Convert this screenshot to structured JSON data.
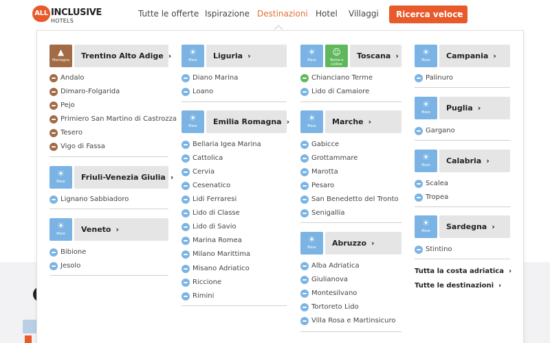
{
  "logo": {
    "all": "ALL",
    "inclusive": "INCLUSIVE",
    "hotels": "HOTELS"
  },
  "nav": {
    "items": [
      "Tutte le offerte",
      "Ispirazione",
      "Destinazioni",
      "Hotel",
      "Villaggi"
    ],
    "active": "Destinazioni",
    "cta": "Ricerca veloce",
    "chevron": "›"
  },
  "badges": {
    "mare": "Mare",
    "montagna": "Montagna",
    "terme": "Terme e colline"
  },
  "colors": {
    "accent": "#e85a2a",
    "mare": "#7bb4e4",
    "montagna": "#a26b45",
    "terme": "#5fb85c"
  },
  "regions": {
    "trentino": {
      "name": "Trentino Alto Adige",
      "items": [
        "Andalo",
        "Dimaro-Folgarida",
        "Pejo",
        "Primiero San Martino di Castrozza",
        "Tesero",
        "Vigo di Fassa"
      ]
    },
    "friuli": {
      "name": "Friuli-Venezia Giulia",
      "items": [
        "Lignano Sabbiadoro"
      ]
    },
    "veneto": {
      "name": "Veneto",
      "items": [
        "Bibione",
        "Jesolo"
      ]
    },
    "liguria": {
      "name": "Liguria",
      "items": [
        "Diano Marina",
        "Loano"
      ]
    },
    "emilia": {
      "name": "Emilia Romagna",
      "items": [
        "Bellaria Igea Marina",
        "Cattolica",
        "Cervia",
        "Cesenatico",
        "Lidi Ferraresi",
        "Lido di Classe",
        "Lido di Savio",
        "Marina Romea",
        "Milano Marittima",
        "Misano Adriatico",
        "Riccione",
        "Rimini"
      ]
    },
    "toscana": {
      "name": "Toscana",
      "items": [
        "Chianciano Terme",
        "Lido di Camaiore"
      ]
    },
    "marche": {
      "name": "Marche",
      "items": [
        "Gabicce",
        "Grottammare",
        "Marotta",
        "Pesaro",
        "San Benedetto del Tronto",
        "Senigallia"
      ]
    },
    "abruzzo": {
      "name": "Abruzzo",
      "items": [
        "Alba Adriatica",
        "Giulianova",
        "Montesilvano",
        "Tortoreto Lido",
        "Villa Rosa e Martinsicuro"
      ]
    },
    "campania": {
      "name": "Campania",
      "items": [
        "Palinuro"
      ]
    },
    "puglia": {
      "name": "Puglia",
      "items": [
        "Gargano"
      ]
    },
    "calabria": {
      "name": "Calabria",
      "items": [
        "Scalea",
        "Tropea"
      ]
    },
    "sardegna": {
      "name": "Sardegna",
      "items": [
        "Stintino"
      ]
    }
  },
  "links": {
    "costa": "Tutta la costa adriatica",
    "tutte": "Tutte le destinazioni"
  }
}
